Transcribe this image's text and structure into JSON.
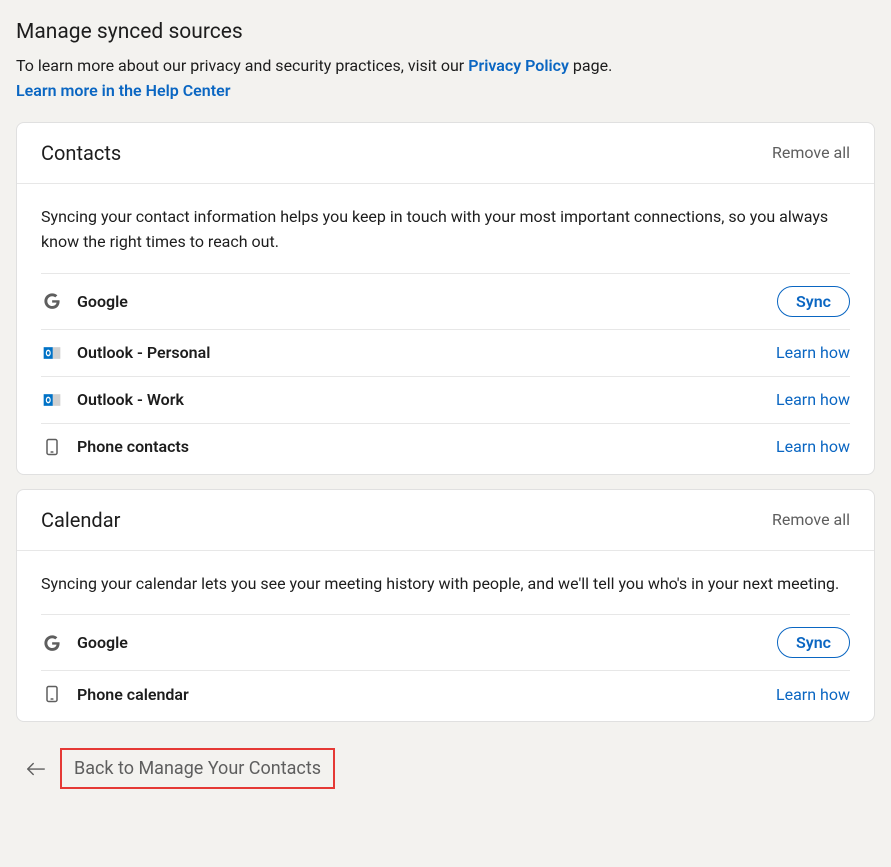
{
  "page": {
    "title": "Manage synced sources",
    "intro_prefix": "To learn more about our privacy and security practices, visit our ",
    "privacy_link_text": "Privacy Policy",
    "intro_suffix": " page.",
    "help_link_text": "Learn more in the Help Center"
  },
  "labels": {
    "remove_all": "Remove all",
    "sync": "Sync",
    "learn_how": "Learn how"
  },
  "sections": {
    "contacts": {
      "heading": "Contacts",
      "description": "Syncing your contact information helps you keep in touch with your most important connections, so you always know the right times to reach out.",
      "items": [
        {
          "icon": "google",
          "name": "Google",
          "action": "sync"
        },
        {
          "icon": "outlook",
          "name": "Outlook - Personal",
          "action": "learn"
        },
        {
          "icon": "outlook",
          "name": "Outlook - Work",
          "action": "learn"
        },
        {
          "icon": "phone",
          "name": "Phone contacts",
          "action": "learn"
        }
      ]
    },
    "calendar": {
      "heading": "Calendar",
      "description": "Syncing your calendar lets you see your meeting history with people, and we'll tell you who's in your next meeting.",
      "items": [
        {
          "icon": "google",
          "name": "Google",
          "action": "sync"
        },
        {
          "icon": "phone",
          "name": "Phone calendar",
          "action": "learn"
        }
      ]
    }
  },
  "back": {
    "label": "Back to Manage Your Contacts"
  }
}
